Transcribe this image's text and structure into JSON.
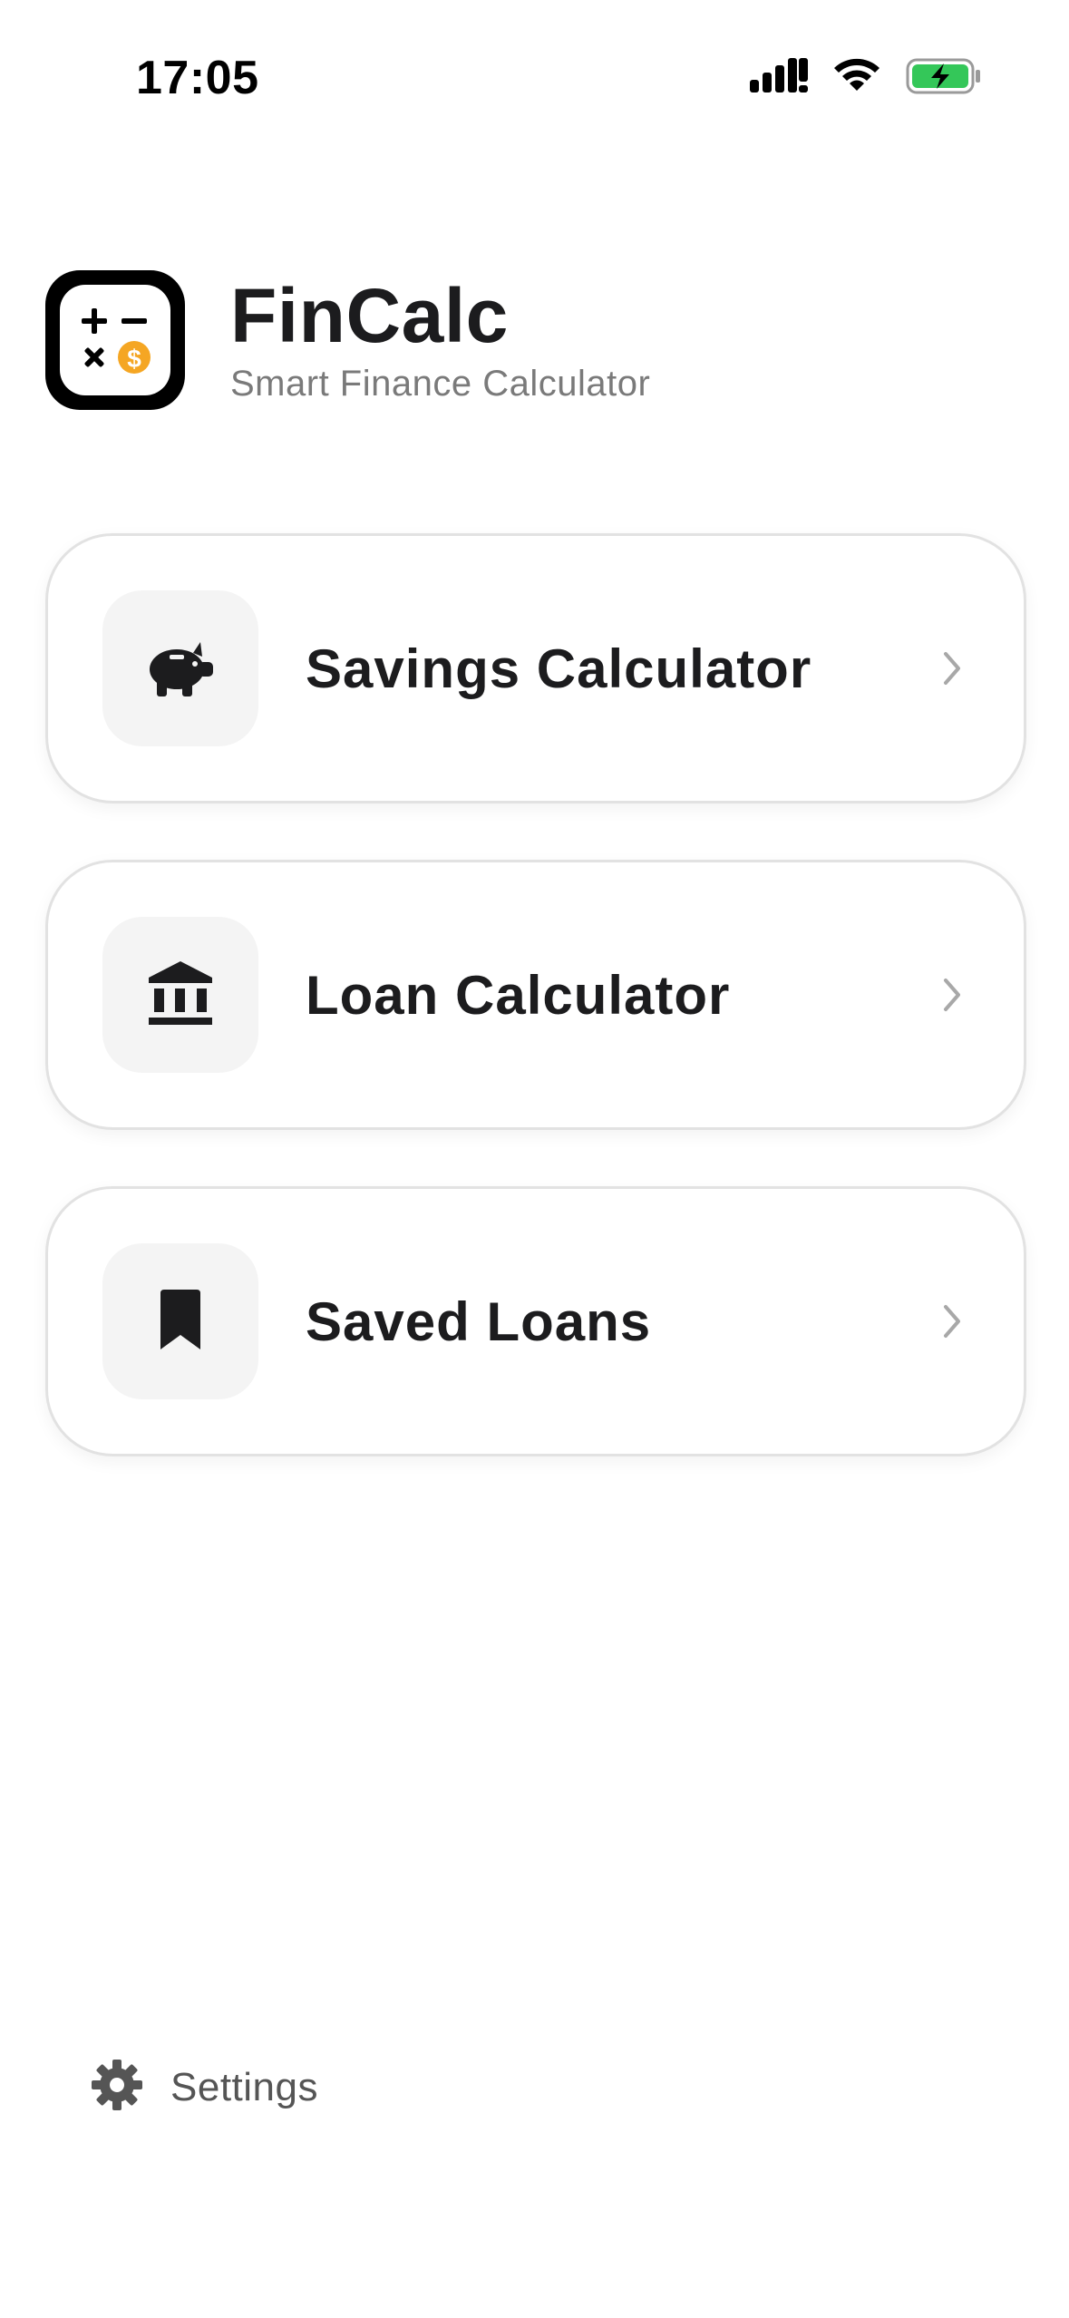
{
  "status_bar": {
    "time": "17:05",
    "icons": [
      "cellular-signal-icon",
      "wifi-icon",
      "battery-charging-icon"
    ],
    "battery_color": "#34c759"
  },
  "header": {
    "title": "FinCalc",
    "subtitle": "Smart Finance Calculator",
    "logo_icon": "calculator-dollar-icon",
    "logo_accent": "#f5a623"
  },
  "menu": {
    "items": [
      {
        "label": "Savings Calculator",
        "icon": "piggy-bank-icon"
      },
      {
        "label": "Loan Calculator",
        "icon": "bank-icon"
      },
      {
        "label": "Saved Loans",
        "icon": "bookmark-icon"
      }
    ]
  },
  "footer": {
    "settings_label": "Settings",
    "settings_icon": "gear-icon"
  }
}
